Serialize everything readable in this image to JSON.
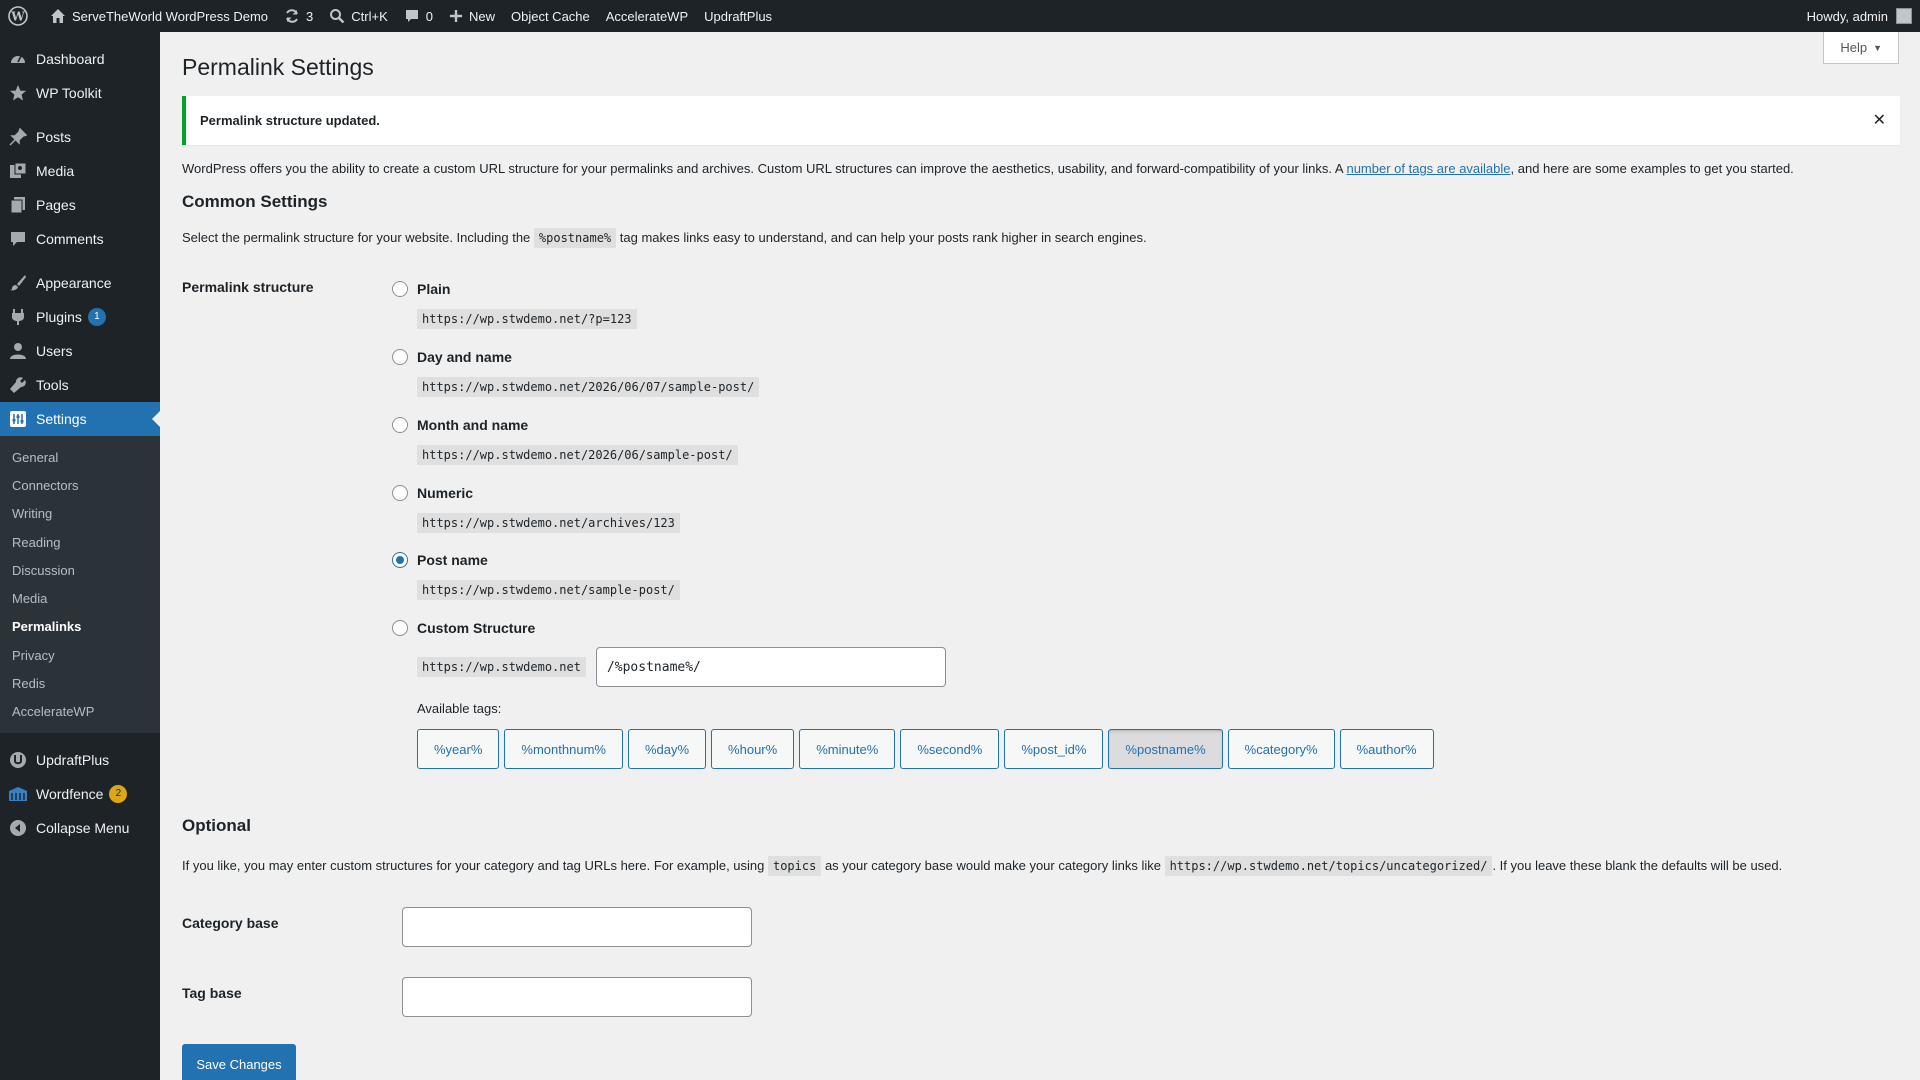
{
  "adminbar": {
    "site_name": "ServeTheWorld WordPress Demo",
    "updates_count": "3",
    "search_shortcut": "Ctrl+K",
    "comments_count": "0",
    "new_label": "New",
    "object_cache": "Object Cache",
    "acceleratewp": "AccelerateWP",
    "updraftplus": "UpdraftPlus",
    "howdy": "Howdy, admin"
  },
  "sidebar": {
    "dashboard": "Dashboard",
    "wp_toolkit": "WP Toolkit",
    "posts": "Posts",
    "media": "Media",
    "pages": "Pages",
    "comments": "Comments",
    "appearance": "Appearance",
    "plugins": "Plugins",
    "plugins_badge": "1",
    "users": "Users",
    "tools": "Tools",
    "settings": "Settings",
    "submenu": [
      "General",
      "Connectors",
      "Writing",
      "Reading",
      "Discussion",
      "Media",
      "Permalinks",
      "Privacy",
      "Redis",
      "AccelerateWP"
    ],
    "updraftplus": "UpdraftPlus",
    "wordfence": "Wordfence",
    "wordfence_badge": "2",
    "collapse": "Collapse Menu"
  },
  "page": {
    "help": "Help",
    "title": "Permalink Settings",
    "notice": "Permalink structure updated.",
    "intro_before": "WordPress offers you the ability to create a custom URL structure for your permalinks and archives. Custom URL structures can improve the aesthetics, usability, and forward-compatibility of your links. A ",
    "intro_link": "number of tags are available",
    "intro_after": ", and here are some examples to get you started.",
    "common_heading": "Common Settings",
    "common_desc_before": "Select the permalink structure for your website. Including the ",
    "common_desc_code": "%postname%",
    "common_desc_after": " tag makes links easy to understand, and can help your posts rank higher in search engines.",
    "permalink_label": "Permalink structure",
    "options": [
      {
        "label": "Plain",
        "example": "https://wp.stwdemo.net/?p=123"
      },
      {
        "label": "Day and name",
        "example": "https://wp.stwdemo.net/2026/06/07/sample-post/"
      },
      {
        "label": "Month and name",
        "example": "https://wp.stwdemo.net/2026/06/sample-post/"
      },
      {
        "label": "Numeric",
        "example": "https://wp.stwdemo.net/archives/123"
      },
      {
        "label": "Post name",
        "example": "https://wp.stwdemo.net/sample-post/"
      },
      {
        "label": "Custom Structure",
        "example": ""
      }
    ],
    "custom_prefix": "https://wp.stwdemo.net",
    "custom_value": "/%postname%/",
    "available_tags_label": "Available tags:",
    "tags": [
      "%year%",
      "%monthnum%",
      "%day%",
      "%hour%",
      "%minute%",
      "%second%",
      "%post_id%",
      "%postname%",
      "%category%",
      "%author%"
    ],
    "optional_heading": "Optional",
    "optional_before": "If you like, you may enter custom structures for your category and tag URLs here. For example, using ",
    "optional_code1": "topics",
    "optional_middle": " as your category base would make your category links like ",
    "optional_code2": "https://wp.stwdemo.net/topics/uncategorized/",
    "optional_after": ". If you leave these blank the defaults will be used.",
    "category_base_label": "Category base",
    "category_base_value": "",
    "tag_base_label": "Tag base",
    "tag_base_value": "",
    "save": "Save Changes"
  }
}
